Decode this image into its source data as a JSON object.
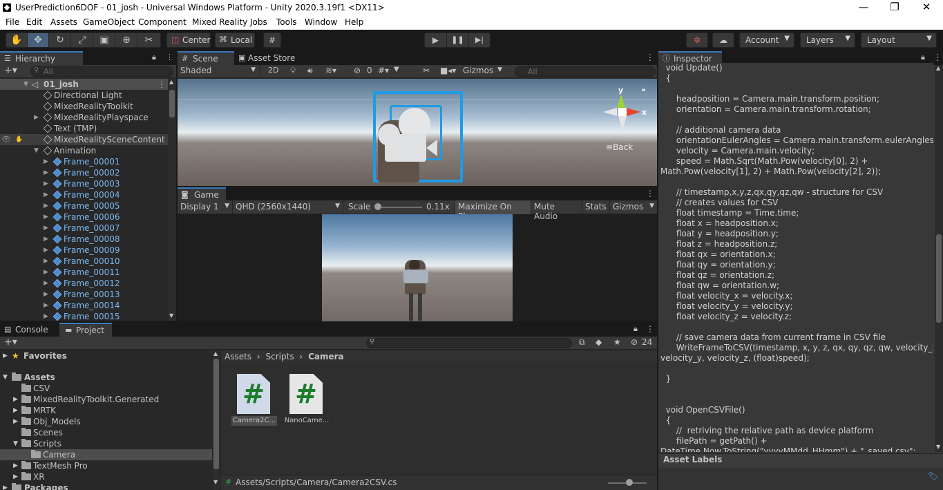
{
  "window": {
    "title": "UserPrediction6DOF - 01_josh - Universal Windows Platform - Unity 2020.3.19f1 <DX11>",
    "minimize": "—",
    "restore": "❐",
    "close": "✕"
  },
  "menu": [
    "File",
    "Edit",
    "Assets",
    "GameObject",
    "Component",
    "Mixed Reality",
    "Jobs",
    "Tools",
    "Window",
    "Help"
  ],
  "toolbar": {
    "center_label": "Center",
    "local_label": "Local",
    "account": "Account",
    "layers": "Layers",
    "layout": "Layout"
  },
  "hierarchy": {
    "tab": "Hierarchy",
    "search_placeholder": "All",
    "scene": "01_josh",
    "items": [
      "Directional Light",
      "MixedRealityToolkit",
      "MixedRealityPlayspace",
      "Text (TMP)",
      "MixedRealitySceneContent",
      "Animation"
    ],
    "frames": [
      "Frame_00001",
      "Frame_00002",
      "Frame_00003",
      "Frame_00004",
      "Frame_00005",
      "Frame_00006",
      "Frame_00007",
      "Frame_00008",
      "Frame_00009",
      "Frame_00010",
      "Frame_00011",
      "Frame_00012",
      "Frame_00013",
      "Frame_00014",
      "Frame_00015"
    ]
  },
  "scene": {
    "tab_scene": "Scene",
    "tab_asset_store": "Asset Store",
    "shading": "Shaded",
    "mode_2d": "2D",
    "hidden_count": "0",
    "gizmos": "Gizmos",
    "search_placeholder": "All",
    "back": "Back",
    "axis_x": "x",
    "axis_y": "y"
  },
  "game": {
    "tab": "Game",
    "display": "Display 1",
    "resolution": "QHD (2560x1440)",
    "scale_label": "Scale",
    "scale_value": "0.11x",
    "maximize": "Maximize On Play",
    "mute": "Mute Audio",
    "stats": "Stats",
    "gizmos": "Gizmos"
  },
  "inspector": {
    "tab": "Inspector",
    "asset_labels": "Asset Labels",
    "code": "  void Update()\n  {\n\n      headposition = Camera.main.transform.position;\n      orientation = Camera.main.transform.rotation;\n\n      // additional camera data\n      orientationEulerAngles = Camera.main.transform.eulerAngles;\n      velocity = Camera.main.velocity;\n      speed = Math.Sqrt(Math.Pow(velocity[0], 2) +\nMath.Pow(velocity[1], 2) + Math.Pow(velocity[2], 2));\n\n      // timestamp,x,y,z,qx,qy,qz,qw - structure for CSV\n      // creates values for CSV\n      float timestamp = Time.time;\n      float x = headposition.x;\n      float y = headposition.y;\n      float z = headposition.z;\n      float qx = orientation.x;\n      float qy = orientation.y;\n      float qz = orientation.z;\n      float qw = orientation.w;\n      float velocity_x = velocity.x;\n      float velocity_y = velocity.y;\n      float velocity_z = velocity.z;\n\n      // save camera data from current frame in CSV file\n      WriteFrameToCSV(timestamp, x, y, z, qx, qy, qz, qw, velocity_x,\nvelocity_y, velocity_z, (float)speed);\n\n  }\n\n\n  void OpenCSVFile()\n  {\n      //  retriving the relative path as device platform\n      filePath = getPath() +\nDateTime.Now.ToString(\"yyyyMMdd_HHmm\") + \"_saved.csv\";"
  },
  "console_tab": "Console",
  "project": {
    "tab": "Project",
    "hidden_count": "24",
    "favorites": "Favorites",
    "assets": "Assets",
    "folders": [
      "CSV",
      "MixedRealityToolkit.Generated",
      "MRTK",
      "Obj_Models",
      "Scenes",
      "Scripts",
      "Camera",
      "TextMesh Pro",
      "XR",
      "Packages"
    ],
    "breadcrumb": [
      "Assets",
      "Scripts",
      "Camera"
    ],
    "files": [
      "Camera2C...",
      "NanoCame..."
    ],
    "file_glyph": "#",
    "status_path": "Assets/Scripts/Camera/Camera2CSV.cs"
  }
}
